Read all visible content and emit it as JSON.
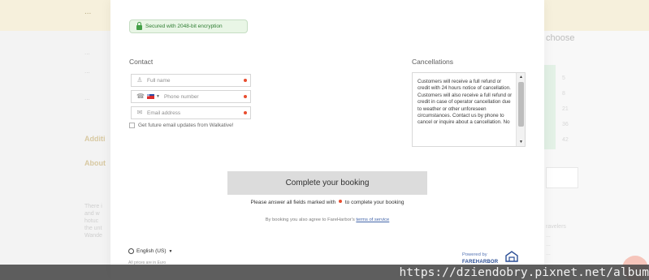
{
  "background": {
    "topbar_text": "...",
    "left_lines": [
      "...",
      "...",
      "..."
    ],
    "left_headings": [
      "Additi",
      "About"
    ],
    "left_paragraph": [
      "There i",
      "and w",
      "hotuc",
      "the unt",
      "Wande"
    ],
    "choose_label": "choose",
    "right_numbers": [
      "5",
      "8",
      "21",
      "36",
      "42"
    ],
    "right_text": [
      "ravelers",
      "...",
      "...",
      "..."
    ]
  },
  "modal": {
    "secure_badge": "Secured with 2048-bit encryption",
    "contact": {
      "title": "Contact",
      "full_name_placeholder": "Full name",
      "phone_placeholder": "Phone number",
      "email_placeholder": "Email address",
      "updates_label": "Get future email updates from Walkative!"
    },
    "cancellations": {
      "title": "Cancellations",
      "text": "Customers will receive a full refund or credit with 24 hours notice of cancellation. Customers will also receive a full refund or credit in case of operator cancellation due to weather or other unforeseen circumstances. Contact us by phone to cancel or inquire about a cancellation. No"
    },
    "complete_button": "Complete your booking",
    "required_note_before": "Please answer all fields marked with",
    "required_note_after": "to complete your booking",
    "terms_before": "By booking you also agree to FareHarbor's",
    "terms_link": "terms of service",
    "language": "English (US)",
    "prices_note": "All prices are in Euro",
    "powered_by": "Powered by",
    "brand": "FAREHARBOR"
  },
  "watermark": "https://dziendobry.pixnet.net/album",
  "colors": {
    "secure_green": "#2e7d32",
    "required_red": "#e84d2f",
    "button_gray": "#dcdcdc",
    "brand_blue": "#2c4f96"
  },
  "icons": {
    "lock": "lock-icon",
    "user": "user-icon",
    "phone": "phone-icon",
    "email": "envelope-icon",
    "globe": "globe-icon",
    "logo": "fareharbor-logo"
  }
}
